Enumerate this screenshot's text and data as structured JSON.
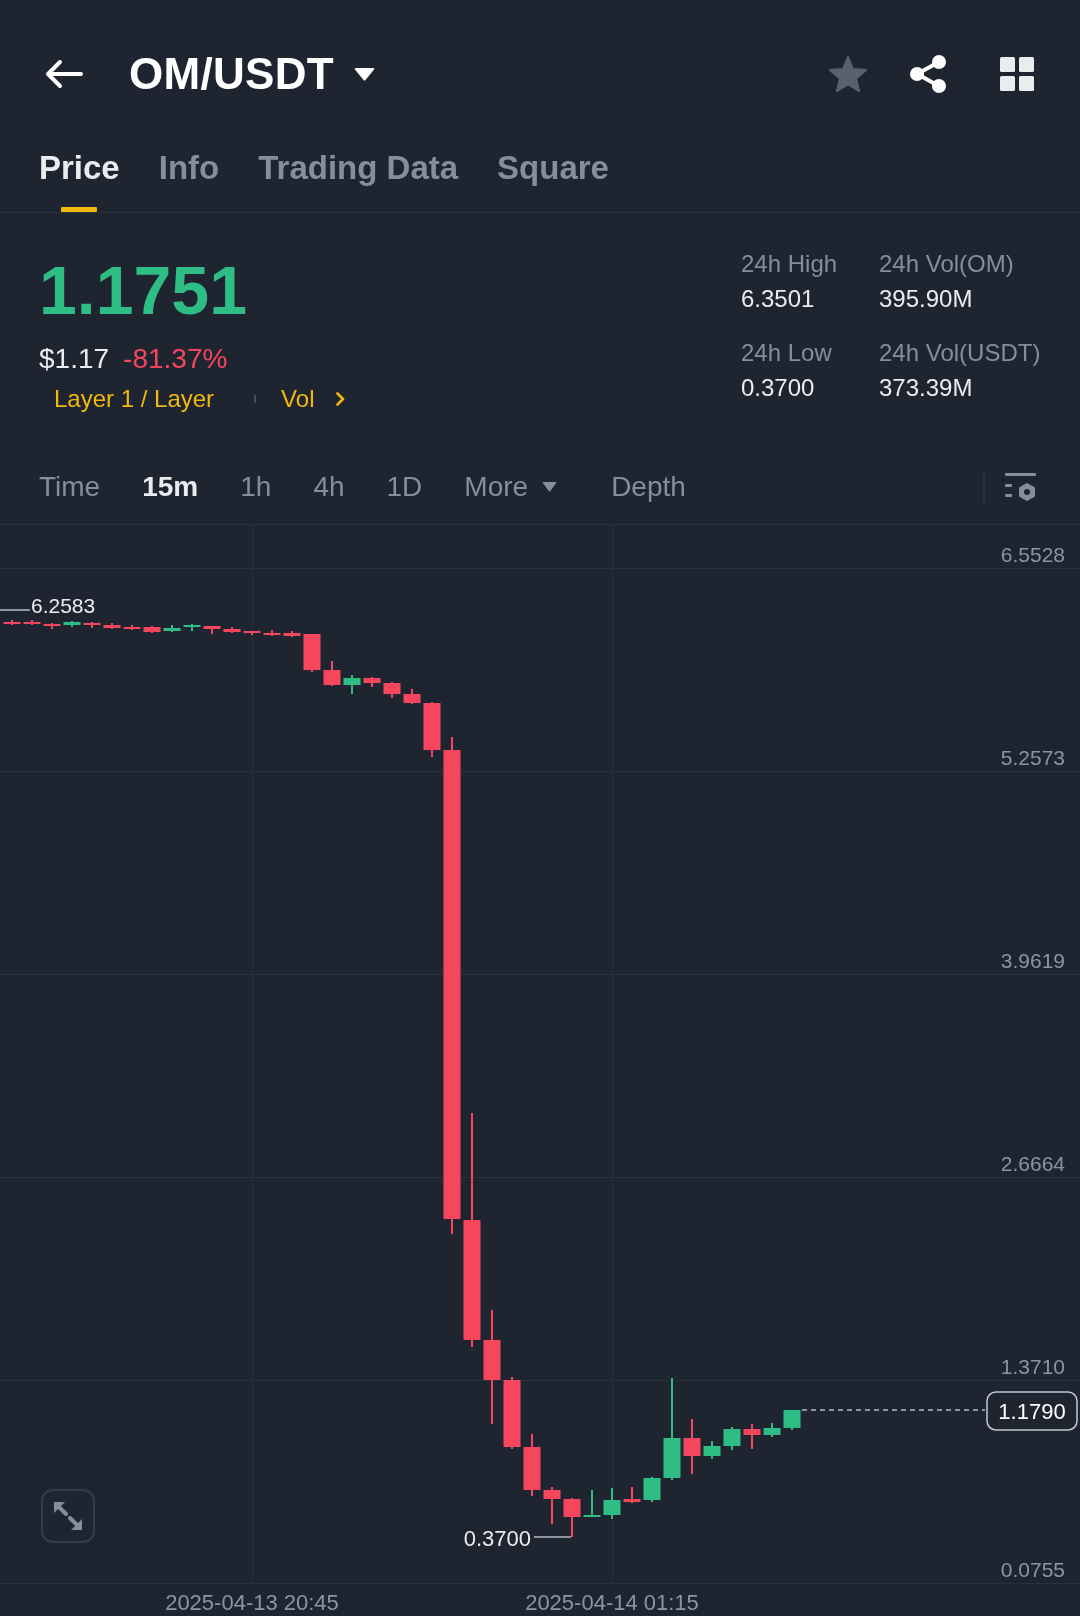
{
  "header": {
    "title": "OM/USDT",
    "favorite": false
  },
  "tabs": [
    {
      "label": "Price",
      "selected": true
    },
    {
      "label": "Info",
      "selected": false
    },
    {
      "label": "Trading Data",
      "selected": false
    },
    {
      "label": "Square",
      "selected": false
    }
  ],
  "ticker": {
    "last_price": "1.1751",
    "fiat_price": "$1.17",
    "change": "-81.37%",
    "tags": [
      "Layer 1 / Layer",
      "Vol"
    ]
  },
  "stats": [
    {
      "label": "24h High",
      "value": "6.3501"
    },
    {
      "label": "24h Vol(OM)",
      "value": "395.90M"
    },
    {
      "label": "24h Low",
      "value": "0.3700"
    },
    {
      "label": "24h Vol(USDT)",
      "value": "373.39M"
    }
  ],
  "intervals": [
    {
      "label": "Time",
      "kind": "option",
      "selected": false
    },
    {
      "label": "15m",
      "kind": "option",
      "selected": true
    },
    {
      "label": "1h",
      "kind": "option",
      "selected": false
    },
    {
      "label": "4h",
      "kind": "option",
      "selected": false
    },
    {
      "label": "1D",
      "kind": "option",
      "selected": false
    },
    {
      "label": "More",
      "kind": "dropdown",
      "selected": false
    },
    {
      "label": "Depth",
      "kind": "view",
      "selected": false
    }
  ],
  "chart": {
    "price_axis": [
      "6.5528",
      "5.2573",
      "3.9619",
      "2.6664",
      "1.3710",
      "0.0755"
    ],
    "time_axis": [
      "2025-04-13 20:45",
      "2025-04-14 01:15"
    ],
    "high_label": "6.2583",
    "low_label": "0.3700",
    "last_price_tag": "1.1790"
  }
}
